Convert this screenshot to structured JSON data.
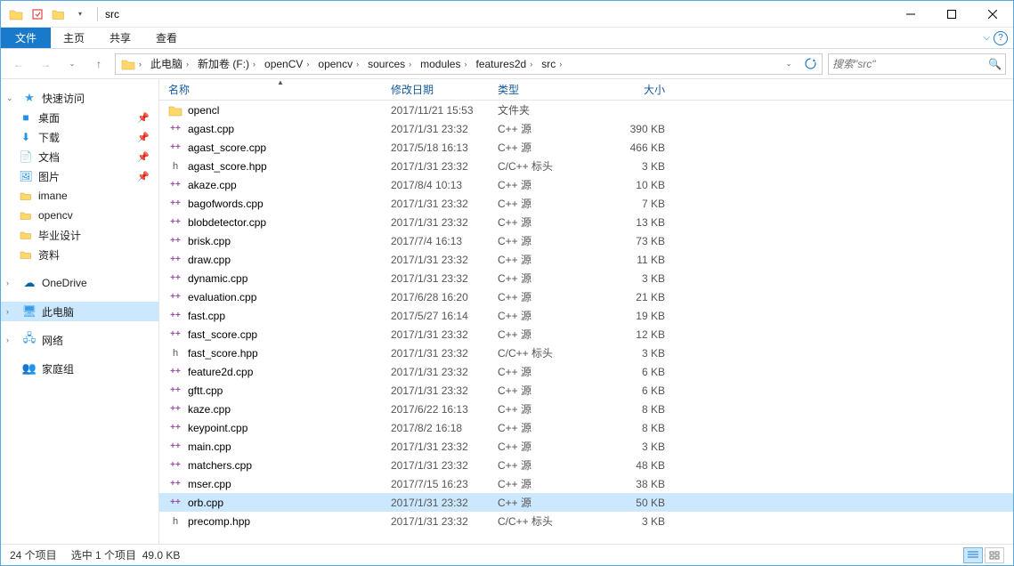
{
  "title": "src",
  "ribbon": {
    "file": "文件",
    "tabs": [
      "主页",
      "共享",
      "查看"
    ]
  },
  "breadcrumbs": [
    "此电脑",
    "新加卷 (F:)",
    "openCV",
    "opencv",
    "sources",
    "modules",
    "features2d",
    "src"
  ],
  "search_placeholder": "搜索\"src\"",
  "sidebar": {
    "quick": {
      "label": "快速访问",
      "items": [
        {
          "icon": "desktop",
          "label": "桌面",
          "pin": true
        },
        {
          "icon": "download",
          "label": "下载",
          "pin": true
        },
        {
          "icon": "doc",
          "label": "文档",
          "pin": true
        },
        {
          "icon": "pic",
          "label": "图片",
          "pin": true
        },
        {
          "icon": "folder",
          "label": "imane"
        },
        {
          "icon": "folder",
          "label": "opencv"
        },
        {
          "icon": "folder",
          "label": "毕业设计"
        },
        {
          "icon": "folder",
          "label": "资料"
        }
      ]
    },
    "onedrive": "OneDrive",
    "thispc": "此电脑",
    "network": "网络",
    "homegroup": "家庭组"
  },
  "columns": {
    "name": "名称",
    "date": "修改日期",
    "type": "类型",
    "size": "大小"
  },
  "files": [
    {
      "icon": "folder",
      "name": "opencl",
      "date": "2017/11/21 15:53",
      "type": "文件夹",
      "size": ""
    },
    {
      "icon": "cpp",
      "name": "agast.cpp",
      "date": "2017/1/31 23:32",
      "type": "C++ 源",
      "size": "390 KB"
    },
    {
      "icon": "cpp",
      "name": "agast_score.cpp",
      "date": "2017/5/18 16:13",
      "type": "C++ 源",
      "size": "466 KB"
    },
    {
      "icon": "hpp",
      "name": "agast_score.hpp",
      "date": "2017/1/31 23:32",
      "type": "C/C++ 标头",
      "size": "3 KB"
    },
    {
      "icon": "cpp",
      "name": "akaze.cpp",
      "date": "2017/8/4 10:13",
      "type": "C++ 源",
      "size": "10 KB"
    },
    {
      "icon": "cpp",
      "name": "bagofwords.cpp",
      "date": "2017/1/31 23:32",
      "type": "C++ 源",
      "size": "7 KB"
    },
    {
      "icon": "cpp",
      "name": "blobdetector.cpp",
      "date": "2017/1/31 23:32",
      "type": "C++ 源",
      "size": "13 KB"
    },
    {
      "icon": "cpp",
      "name": "brisk.cpp",
      "date": "2017/7/4 16:13",
      "type": "C++ 源",
      "size": "73 KB"
    },
    {
      "icon": "cpp",
      "name": "draw.cpp",
      "date": "2017/1/31 23:32",
      "type": "C++ 源",
      "size": "11 KB"
    },
    {
      "icon": "cpp",
      "name": "dynamic.cpp",
      "date": "2017/1/31 23:32",
      "type": "C++ 源",
      "size": "3 KB"
    },
    {
      "icon": "cpp",
      "name": "evaluation.cpp",
      "date": "2017/6/28 16:20",
      "type": "C++ 源",
      "size": "21 KB"
    },
    {
      "icon": "cpp",
      "name": "fast.cpp",
      "date": "2017/5/27 16:14",
      "type": "C++ 源",
      "size": "19 KB"
    },
    {
      "icon": "cpp",
      "name": "fast_score.cpp",
      "date": "2017/1/31 23:32",
      "type": "C++ 源",
      "size": "12 KB"
    },
    {
      "icon": "hpp",
      "name": "fast_score.hpp",
      "date": "2017/1/31 23:32",
      "type": "C/C++ 标头",
      "size": "3 KB"
    },
    {
      "icon": "cpp",
      "name": "feature2d.cpp",
      "date": "2017/1/31 23:32",
      "type": "C++ 源",
      "size": "6 KB"
    },
    {
      "icon": "cpp",
      "name": "gftt.cpp",
      "date": "2017/1/31 23:32",
      "type": "C++ 源",
      "size": "6 KB"
    },
    {
      "icon": "cpp",
      "name": "kaze.cpp",
      "date": "2017/6/22 16:13",
      "type": "C++ 源",
      "size": "8 KB"
    },
    {
      "icon": "cpp",
      "name": "keypoint.cpp",
      "date": "2017/8/2 16:18",
      "type": "C++ 源",
      "size": "8 KB"
    },
    {
      "icon": "cpp",
      "name": "main.cpp",
      "date": "2017/1/31 23:32",
      "type": "C++ 源",
      "size": "3 KB"
    },
    {
      "icon": "cpp",
      "name": "matchers.cpp",
      "date": "2017/1/31 23:32",
      "type": "C++ 源",
      "size": "48 KB"
    },
    {
      "icon": "cpp",
      "name": "mser.cpp",
      "date": "2017/7/15 16:23",
      "type": "C++ 源",
      "size": "38 KB"
    },
    {
      "icon": "cpp",
      "name": "orb.cpp",
      "date": "2017/1/31 23:32",
      "type": "C++ 源",
      "size": "50 KB",
      "selected": true
    },
    {
      "icon": "hpp",
      "name": "precomp.hpp",
      "date": "2017/1/31 23:32",
      "type": "C/C++ 标头",
      "size": "3 KB"
    }
  ],
  "status": {
    "items": "24 个项目",
    "selected": "选中 1 个项目",
    "size": "49.0 KB"
  }
}
